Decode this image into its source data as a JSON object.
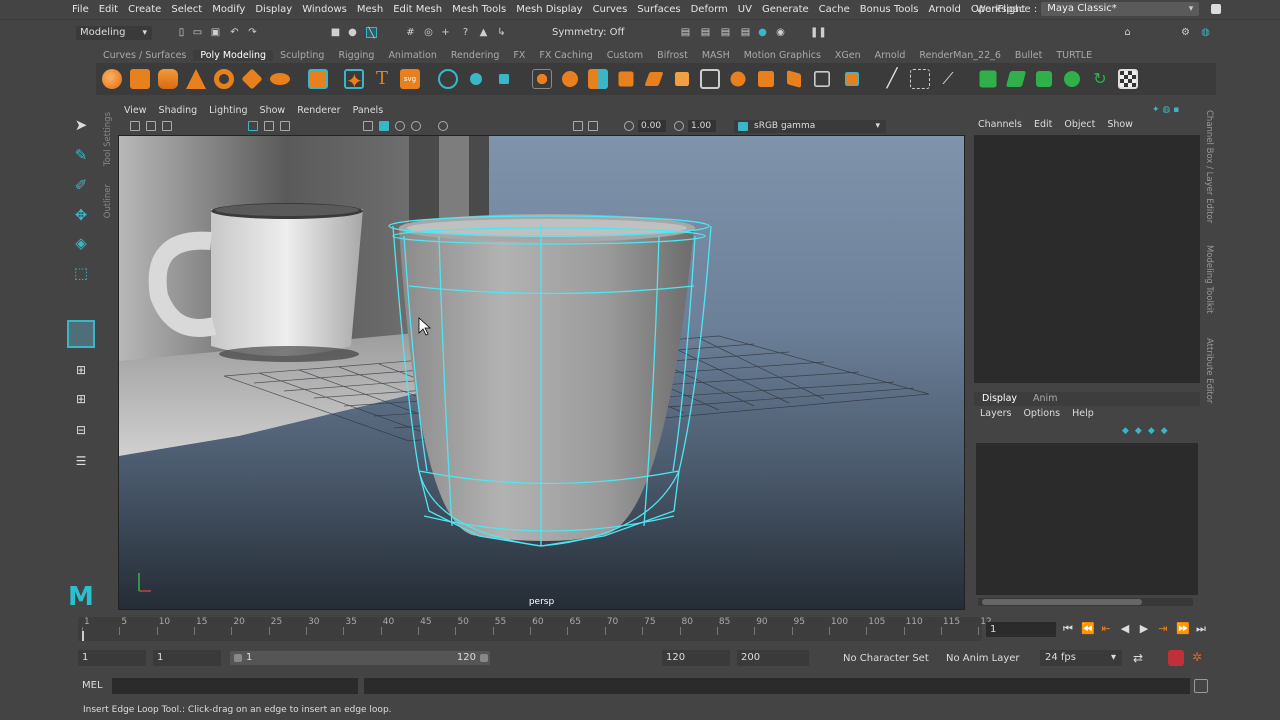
{
  "menubar": {
    "items": [
      "File",
      "Edit",
      "Create",
      "Select",
      "Modify",
      "Display",
      "Windows",
      "Mesh",
      "Edit Mesh",
      "Mesh Tools",
      "Mesh Display",
      "Curves",
      "Surfaces",
      "Deform",
      "UV",
      "Generate",
      "Cache",
      "Bonus Tools",
      "Arnold",
      "OpenFlight"
    ],
    "workspace_label": "Workspace :",
    "workspace_value": "Maya Classic*"
  },
  "statusline": {
    "mode": "Modeling",
    "symmetry": "Symmetry: Off"
  },
  "shelf": {
    "tabs": [
      "Curves / Surfaces",
      "Poly Modeling",
      "Sculpting",
      "Rigging",
      "Animation",
      "Rendering",
      "FX",
      "FX Caching",
      "Custom",
      "Bifrost",
      "MASH",
      "Motion Graphics",
      "XGen",
      "Arnold",
      "RenderMan_22_6",
      "Bullet",
      "TURTLE"
    ],
    "active_tab": "Poly Modeling"
  },
  "toolbox": {
    "tabs": [
      "Tool Settings",
      "Outliner"
    ]
  },
  "viewport": {
    "menu": [
      "View",
      "Shading",
      "Lighting",
      "Show",
      "Renderer",
      "Panels"
    ],
    "exposure": "0.00",
    "gamma": "1.00",
    "color_space": "sRGB gamma",
    "camera": "persp"
  },
  "channelbox": {
    "menu": [
      "Channels",
      "Edit",
      "Object",
      "Show"
    ],
    "layer_tabs": [
      "Display",
      "Anim"
    ],
    "layer_menu": [
      "Layers",
      "Options",
      "Help"
    ],
    "side_tabs": [
      "Channel Box / Layer Editor",
      "Modeling Toolkit",
      "Attribute Editor"
    ]
  },
  "timeline": {
    "ticks": [
      "1",
      "5",
      "10",
      "15",
      "20",
      "25",
      "30",
      "35",
      "40",
      "45",
      "50",
      "55",
      "60",
      "65",
      "70",
      "75",
      "80",
      "85",
      "90",
      "95",
      "100",
      "105",
      "110",
      "115",
      "12"
    ],
    "current_frame": "1"
  },
  "range": {
    "start": "1",
    "playback_start": "1",
    "range_start_label": "1",
    "range_end_label": "120",
    "playback_end": "120",
    "end": "200",
    "character_set": "No Character Set",
    "anim_layer": "No Anim Layer",
    "fps": "24 fps"
  },
  "command": {
    "language": "MEL"
  },
  "help_line": "Insert Edge Loop Tool.: Click-drag on an edge to insert an edge loop.",
  "logo_text": "M",
  "colors": {
    "accent": "#39b7c9",
    "wireframe": "#4ee6f2",
    "viewport_top": "#7f93ab",
    "viewport_bottom": "#252c35"
  }
}
